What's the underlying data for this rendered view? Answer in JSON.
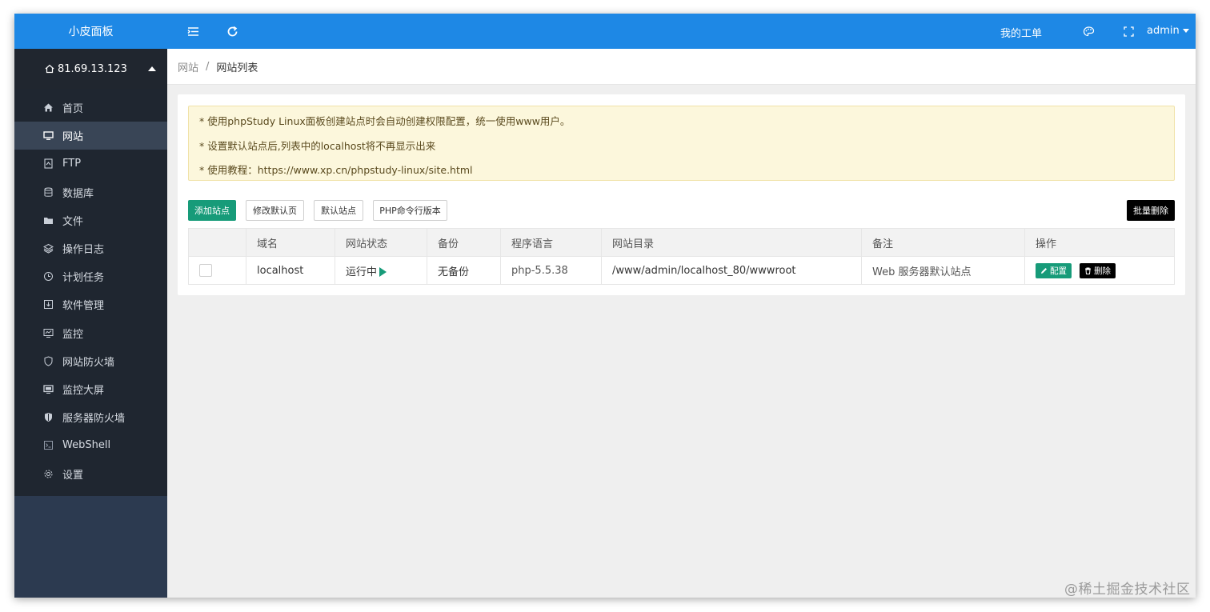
{
  "app": {
    "title": "小皮面板"
  },
  "server": {
    "label": "81.69.13.123"
  },
  "sidebar": {
    "items": [
      {
        "label": "首页",
        "icon": "home-icon"
      },
      {
        "label": "网站",
        "icon": "monitor-icon",
        "active": true
      },
      {
        "label": "FTP",
        "icon": "ftp-icon"
      },
      {
        "label": "数据库",
        "icon": "database-icon"
      },
      {
        "label": "文件",
        "icon": "folder-icon"
      },
      {
        "label": "操作日志",
        "icon": "layers-icon"
      },
      {
        "label": "计划任务",
        "icon": "clock-icon"
      },
      {
        "label": "软件管理",
        "icon": "download-box-icon"
      },
      {
        "label": "监控",
        "icon": "chart-monitor-icon"
      },
      {
        "label": "网站防火墙",
        "icon": "shield-icon"
      },
      {
        "label": "监控大屏",
        "icon": "screen-icon"
      },
      {
        "label": "服务器防火墙",
        "icon": "shield-half-icon"
      },
      {
        "label": "WebShell",
        "icon": "terminal-icon"
      },
      {
        "label": "设置",
        "icon": "gear-icon"
      }
    ]
  },
  "topbar": {
    "my_tickets": "我的工单",
    "user": "admin"
  },
  "breadcrumb": {
    "parent": "网站",
    "separator": "/",
    "current": "网站列表"
  },
  "notice": {
    "lines": [
      "* 使用phpStudy Linux面板创建站点时会自动创建权限配置，统一使用www用户。",
      "* 设置默认站点后,列表中的localhost将不再显示出来",
      "* 使用教程：https://www.xp.cn/phpstudy-linux/site.html"
    ]
  },
  "toolbar": {
    "add_site": "添加站点",
    "edit_default_page": "修改默认页",
    "default_site": "默认站点",
    "php_cli_version": "PHP命令行版本",
    "batch_delete": "批量删除"
  },
  "table": {
    "headers": [
      "",
      "域名",
      "网站状态",
      "备份",
      "程序语言",
      "网站目录",
      "备注",
      "操作"
    ],
    "rows": [
      {
        "domain": "localhost",
        "status": "运行中",
        "backup": "无备份",
        "language": "php-5.5.38",
        "directory": "/www/admin/localhost_80/wwwroot",
        "note": "Web 服务器默认站点",
        "config_label": "配置",
        "delete_label": "删除"
      }
    ]
  },
  "watermark": "@稀土掘金技术社区",
  "colors": {
    "primary": "#1e88e5",
    "sidebar": "#1f2630",
    "green": "#179b79",
    "notice_bg": "#fcf7dc"
  }
}
